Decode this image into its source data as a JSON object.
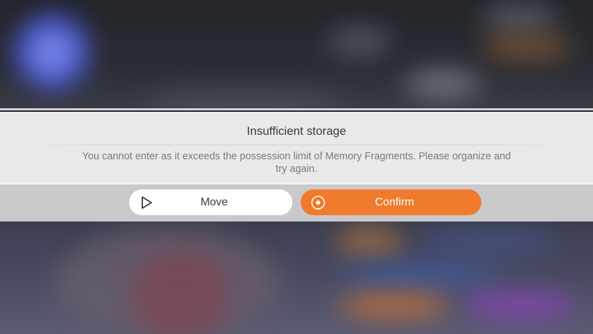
{
  "dialog": {
    "title": "Insufficient storage",
    "message": "You cannot enter as it exceeds the possession limit of Memory Fragments. Please organize and try again."
  },
  "buttons": {
    "move": {
      "label": "Move",
      "icon": "play-outline-icon"
    },
    "confirm": {
      "label": "Confirm",
      "icon": "target-circle-icon"
    }
  },
  "colors": {
    "confirm_accent": "#f07b2c",
    "dialog_bg": "#e9e9ea",
    "button_bar_bg": "#c9c9cb"
  }
}
